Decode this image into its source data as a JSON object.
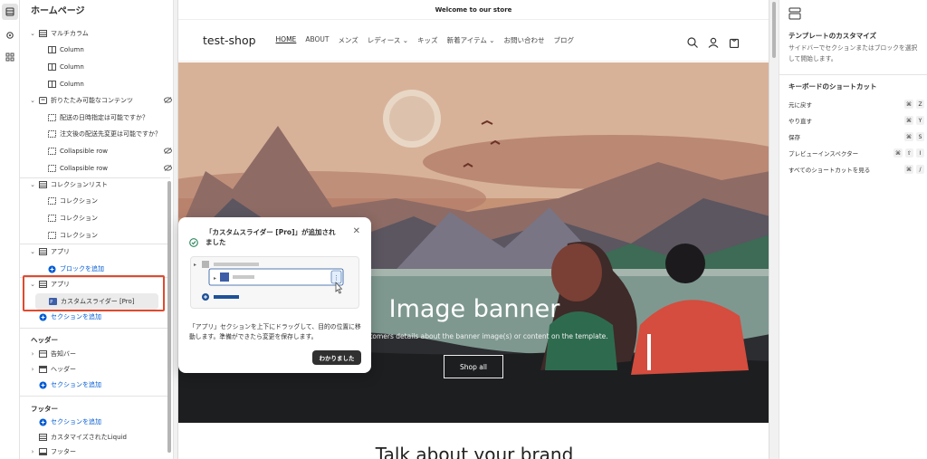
{
  "sidebar": {
    "title": "ホームページ",
    "rows": [
      {
        "label": "マルチカラム",
        "type": "section"
      },
      {
        "label": "Column",
        "type": "block"
      },
      {
        "label": "Column",
        "type": "block"
      },
      {
        "label": "Column",
        "type": "block"
      },
      {
        "label": "折りたたみ可能なコンテンツ",
        "type": "section"
      },
      {
        "label": "配送の日時指定は可能ですか？",
        "type": "dashed"
      },
      {
        "label": "注文後の配送先変更は可能ですか？",
        "type": "dashed"
      },
      {
        "label": "Collapsible row",
        "type": "dashed"
      },
      {
        "label": "Collapsible row",
        "type": "dashed"
      },
      {
        "label": "コレクションリスト",
        "type": "section"
      },
      {
        "label": "コレクション",
        "type": "dashed"
      },
      {
        "label": "コレクション",
        "type": "dashed"
      },
      {
        "label": "コレクション",
        "type": "dashed"
      },
      {
        "label": "アプリ",
        "type": "section"
      },
      {
        "label": "ブロックを追加",
        "type": "add"
      },
      {
        "label": "アプリ",
        "type": "section"
      },
      {
        "label": "カスタムスライダー [Pro]",
        "type": "app"
      },
      {
        "label": "セクションを追加",
        "type": "add"
      }
    ],
    "header_group": {
      "title": "ヘッダー",
      "rows": [
        {
          "label": "告知バー"
        },
        {
          "label": "ヘッダー"
        },
        {
          "label": "セクションを追加"
        }
      ]
    },
    "footer_group": {
      "title": "フッター",
      "rows": [
        {
          "label": "セクションを追加"
        },
        {
          "label": "カスタマイズされたLiquid"
        },
        {
          "label": "フッター"
        }
      ]
    }
  },
  "store": {
    "announcement": "Welcome to our store",
    "logo": "test-shop",
    "nav": [
      "HOME",
      "ABOUT",
      "メンズ",
      "レディース",
      "キッズ",
      "新着アイテム",
      "お問い合わせ",
      "ブログ"
    ],
    "banner_title": "Image banner",
    "banner_sub": "Give customers details about the banner image(s) or content on the template.",
    "banner_button": "Shop all",
    "brand_heading": "Talk about your brand"
  },
  "popover": {
    "title": "「カスタムスライダー [Pro]」が追加されました",
    "body": "「アプリ」セクションを上下にドラッグして、目的の位置に移動します。準備ができたら変更を保存します。",
    "button": "わかりました"
  },
  "right_panel": {
    "title": "テンプレートのカスタマイズ",
    "desc": "サイドバーでセクションまたはブロックを選択して開始します。",
    "kb_title": "キーボードのショートカット",
    "shortcuts": [
      {
        "label": "元に戻す",
        "keys": [
          "⌘",
          "Z"
        ]
      },
      {
        "label": "やり直す",
        "keys": [
          "⌘",
          "Y"
        ]
      },
      {
        "label": "保存",
        "keys": [
          "⌘",
          "S"
        ]
      },
      {
        "label": "プレビューインスペクター",
        "keys": [
          "⌘",
          "⇧",
          "I"
        ]
      },
      {
        "label": "すべてのショートカットを見る",
        "keys": [
          "⌘",
          "/"
        ]
      }
    ]
  },
  "colors": {
    "accent": "#005bd3",
    "highlight": "#e04a2f",
    "dark": "#303030"
  }
}
